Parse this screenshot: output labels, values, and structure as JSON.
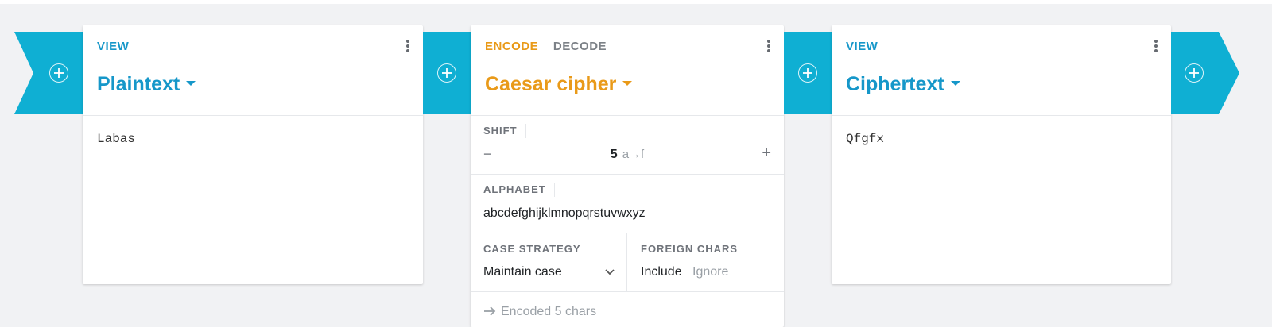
{
  "colors": {
    "accent_blue": "#0fafd3",
    "title_blue": "#1697c9",
    "orange": "#e99a19"
  },
  "cards": [
    {
      "label": "VIEW",
      "title": "Plaintext",
      "content": "Labas"
    },
    {
      "labels": [
        "ENCODE",
        "DECODE"
      ],
      "title": "Caesar cipher",
      "shift": {
        "label": "SHIFT",
        "value": "5",
        "mapping": "a→f",
        "minus": "−",
        "plus": "+"
      },
      "alphabet": {
        "label": "ALPHABET",
        "value": "abcdefghijklmnopqrstuvwxyz"
      },
      "case_strategy": {
        "label": "CASE STRATEGY",
        "value": "Maintain case"
      },
      "foreign_chars": {
        "label": "FOREIGN CHARS",
        "include": "Include",
        "ignore": "Ignore"
      },
      "status": "Encoded 5 chars"
    },
    {
      "label": "VIEW",
      "title": "Ciphertext",
      "content": "Qfgfx"
    }
  ],
  "icons": [
    "plus-icon",
    "kebab-menu-icon",
    "caret-down-icon",
    "chevron-down-icon",
    "arrow-right-icon"
  ]
}
